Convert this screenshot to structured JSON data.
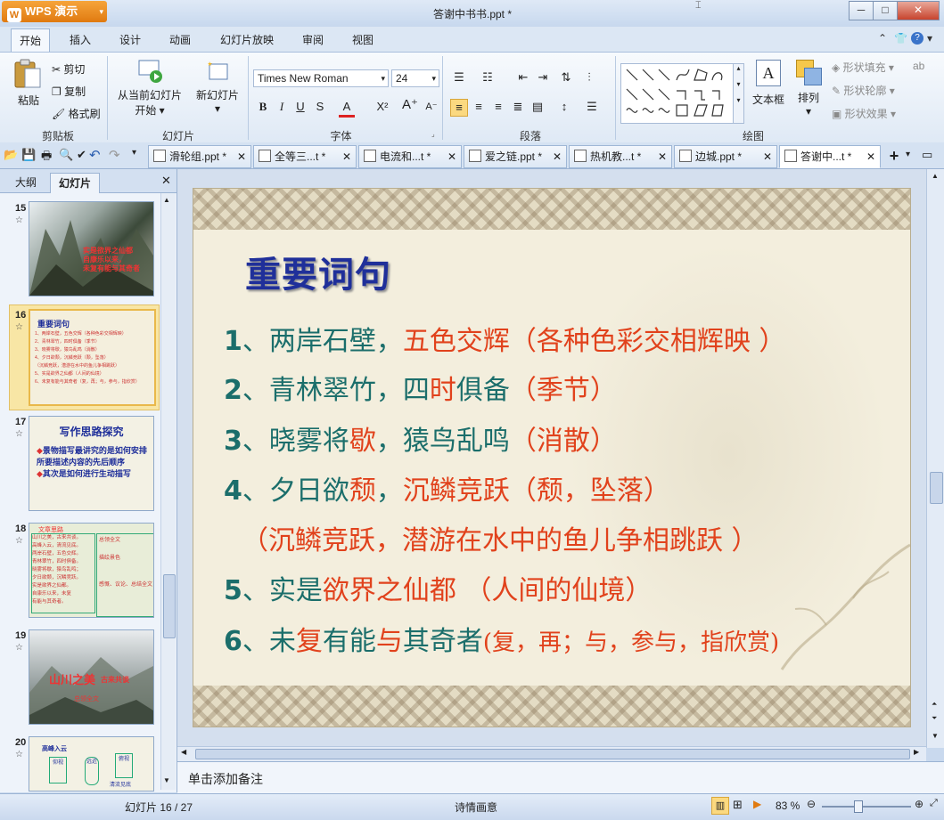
{
  "app": {
    "name": "WPS 演示",
    "title": "答谢中书书.ppt *"
  },
  "ribbon_tabs": [
    "开始",
    "插入",
    "设计",
    "动画",
    "幻灯片放映",
    "审阅",
    "视图"
  ],
  "clipboard": {
    "paste": "粘贴",
    "cut": "剪切",
    "copy": "复制",
    "format_painter": "格式刷",
    "label": "剪贴板"
  },
  "slides_group": {
    "from_current": "从当前幻灯片",
    "start": "开始",
    "new_slide": "新幻灯片",
    "label": "幻灯片"
  },
  "font": {
    "name": "Times New Roman",
    "size": "24",
    "label": "字体"
  },
  "paragraph": {
    "label": "段落"
  },
  "drawing": {
    "textbox": "文本框",
    "arrange": "排列",
    "fill": "形状填充",
    "outline": "形状轮廓",
    "effect": "形状效果",
    "label": "绘图"
  },
  "doc_tabs": [
    "滑轮组.ppt *",
    "全等三...t *",
    "电流和...t *",
    "爱之链.ppt *",
    "热机教...t *",
    "边城.ppt *",
    "答谢中...t *"
  ],
  "panel_tabs": [
    "大纲",
    "幻灯片"
  ],
  "thumbnails": {
    "s15": {
      "num": "15",
      "lines": [
        "实是欲界之仙都",
        "自康乐以来，",
        "未复有能与其奇者"
      ]
    },
    "s16": {
      "num": "16",
      "title": "重要词句",
      "lines": [
        "1、两岸石壁，五色交辉（各种色彩交相辉映）",
        "2、青林翠竹，四时俱备（季节）",
        "3、晓雾将歇，猿鸟乱鸣（消散）",
        "4、夕日欲颓，沉鳞竞跃（颓，坠落）",
        "（沉鳞竞跃，潜游在水中的鱼儿争相跳跃）",
        "5、实是欲界之仙都（人间的仙境）",
        "6、未复有能与其奇者（复，再；与，参与，指欣赏）"
      ]
    },
    "s17": {
      "num": "17",
      "title": "写作思路探究",
      "lines": [
        "景物描写最讲究的是如何安排所要描述内容的先后顺序",
        "其次是如何进行生动描写"
      ]
    },
    "s18": {
      "num": "18",
      "head": "文章思路",
      "left": [
        "山川之美，古来共谈。",
        "高峰入云，清流见底。",
        "两岸石壁，五色交辉。",
        "青林翠竹，四时俱备。",
        "晓雾将歇，猿鸟乱鸣；",
        "夕日欲颓，沉鳞竞跃。",
        "实是欲界之仙都。",
        "自康乐以来，未复",
        "有能与其奇者。"
      ],
      "right": [
        "总领全文",
        "描绘景色",
        "感慨、议论、总结全文"
      ]
    },
    "s19": {
      "num": "19",
      "big": "山川之美",
      "small": "古来共谈",
      "sub": "总领全文"
    },
    "s20": {
      "num": "20",
      "top": "高峰入云",
      "a": "仰视",
      "b": "俯视",
      "c": "清流见底",
      "d": "远近"
    }
  },
  "slide": {
    "title": "重要词句",
    "lines": [
      {
        "num": "1",
        "parts": [
          [
            "、两岸石壁，",
            "t"
          ],
          [
            "五色交辉（各种色彩交相辉映 ）",
            "r"
          ]
        ]
      },
      {
        "num": "2",
        "parts": [
          [
            "、青林翠竹，四",
            "t"
          ],
          [
            "时",
            "r"
          ],
          [
            "俱备",
            "t"
          ],
          [
            "（季节）",
            "r"
          ]
        ]
      },
      {
        "num": "3",
        "parts": [
          [
            "、晓雾将",
            "t"
          ],
          [
            "歇",
            "r"
          ],
          [
            "，猿鸟乱鸣",
            "t"
          ],
          [
            "（消散）",
            "r"
          ]
        ]
      },
      {
        "num": "4",
        "parts": [
          [
            "、夕日欲",
            "t"
          ],
          [
            "颓",
            "r"
          ],
          [
            "，",
            "t"
          ],
          [
            "沉鳞竞跃（颓，坠落）",
            "r"
          ]
        ]
      },
      {
        "num": "",
        "parts": [
          [
            "（沉鳞竞跃，潜游在水中的鱼儿争相跳跃 ）",
            "r"
          ]
        ]
      },
      {
        "num": "5",
        "parts": [
          [
            "、实是",
            "t"
          ],
          [
            "欲界之仙都 （人间的仙境）",
            "r"
          ]
        ]
      },
      {
        "num": "6",
        "parts": [
          [
            "、未",
            "t"
          ],
          [
            "复",
            "r"
          ],
          [
            "有能",
            "t"
          ],
          [
            "与",
            "r"
          ],
          [
            "其奇者",
            "t"
          ],
          [
            "(复，再；与，参与，指欣赏)",
            "r"
          ]
        ]
      }
    ]
  },
  "notes_placeholder": "单击添加备注",
  "status": {
    "slide_info": "幻灯片 16 / 27",
    "theme": "诗情画意",
    "zoom": "83 %"
  },
  "colors": {
    "teal": "#1b6e6b",
    "red": "#e1421c",
    "title_blue": "#1f2f9a"
  }
}
